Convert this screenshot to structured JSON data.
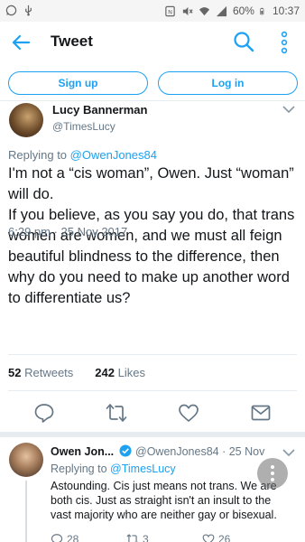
{
  "status_bar": {
    "battery": "60%",
    "time": "10:37"
  },
  "header": {
    "title": "Tweet"
  },
  "auth": {
    "signup_label": "Sign up",
    "login_label": "Log in"
  },
  "tweet": {
    "author_name": "Lucy Bannerman",
    "author_handle": "@TimesLucy",
    "replying_prefix": "Replying to ",
    "replying_handle": "@OwenJones84",
    "text": "I'm not a “cis woman”, Owen. Just “woman” will do.\nIf you believe, as you say you do, that trans women are women, and we must all feign beautiful blindness to the difference, then why do you need to make up another word to differentiate us?",
    "timestamp": "6:29 pm · 25 Nov 2017",
    "retweets_count": "52",
    "retweets_label": "Retweets",
    "likes_count": "242",
    "likes_label": "Likes"
  },
  "reply": {
    "author_name": "Owen Jon...",
    "author_handle": "@OwenJones84 · 25 Nov",
    "replying_prefix": "Replying to ",
    "replying_handle": "@TimesLucy",
    "text": "Astounding. Cis just means not trans. We are both cis. Just as straight isn't an insult to the vast majority who are neither gay or bisexual.",
    "reply_count": "28",
    "retweet_count": "3",
    "like_count": "26"
  },
  "colors": {
    "accent": "#1da1f2",
    "secondary_text": "#657786",
    "divider": "#e6ecf0"
  }
}
